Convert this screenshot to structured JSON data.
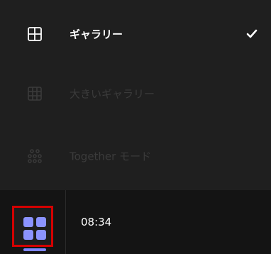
{
  "menu": {
    "items": [
      {
        "label": "ギャラリー",
        "icon": "grid-2x2-icon",
        "state": "selected"
      },
      {
        "label": "大きいギャラリー",
        "icon": "grid-3x3-icon",
        "state": "disabled"
      },
      {
        "label": "Together モード",
        "icon": "people-grid-icon",
        "state": "disabled"
      }
    ],
    "check_icon": "check-icon"
  },
  "bottom_bar": {
    "time": "08:34",
    "layout_button_icon": "layout-grid-icon"
  },
  "colors": {
    "menu_background": "#1f1f1f",
    "bottom_background": "#141414",
    "active_text": "#ffffff",
    "disabled_text": "#3b3b3b",
    "accent": "#7f86ff",
    "highlight_border": "#d40000"
  }
}
